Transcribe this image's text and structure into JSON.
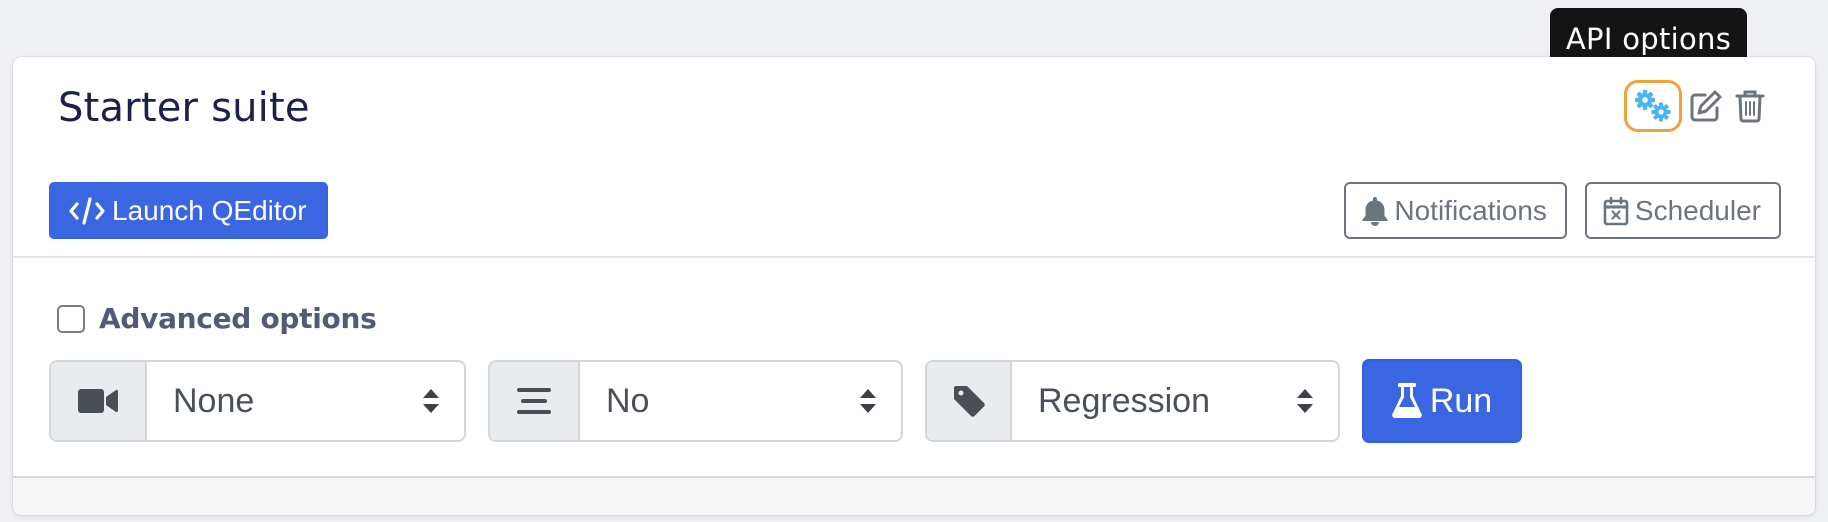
{
  "card": {
    "title": "Starter suite",
    "actions": [
      {
        "name": "api-options",
        "icon": "gears-icon",
        "active": true
      },
      {
        "name": "edit",
        "icon": "edit-icon"
      },
      {
        "name": "delete",
        "icon": "trash-icon"
      }
    ]
  },
  "tooltip": {
    "text": "API options"
  },
  "header": {
    "launch_label": "Launch QEditor",
    "launch_icon": "code-icon",
    "notifications_label": "Notifications",
    "notifications_icon": "bell-icon",
    "scheduler_label": "Scheduler",
    "scheduler_icon": "calendar-x-icon"
  },
  "options": {
    "advanced_label": "Advanced options",
    "advanced_checked": false,
    "selects": [
      {
        "icon": "video-camera-icon",
        "value": "None"
      },
      {
        "icon": "align-lines-icon",
        "value": "No"
      },
      {
        "icon": "tag-icon",
        "value": "Regression"
      }
    ],
    "run_label": "Run",
    "run_icon": "flask-icon"
  },
  "colors": {
    "primary": "#3a66e2",
    "highlight": "#f0a23b",
    "gear": "#4bb6ee",
    "tooltip_bg": "#141414"
  }
}
